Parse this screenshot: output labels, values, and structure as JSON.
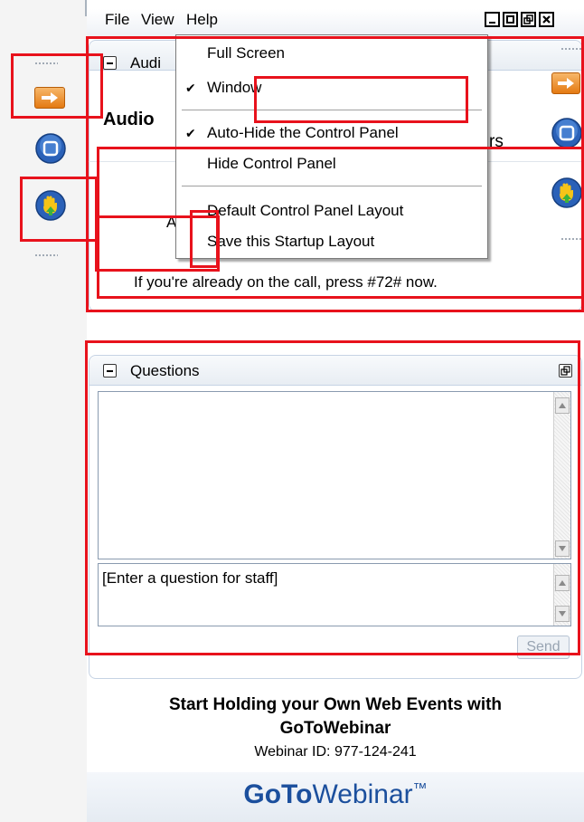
{
  "menubar": {
    "file_label": "File",
    "view_label": "View",
    "help_label": "Help"
  },
  "view_menu": {
    "items": [
      {
        "label": "Full Screen",
        "checked": false
      },
      {
        "label": "Window",
        "checked": true
      },
      {
        "label": "Auto-Hide the Control Panel",
        "checked": true
      },
      {
        "label": "Hide Control Panel",
        "checked": false
      },
      {
        "label": "Default Control Panel Layout",
        "checked": false
      },
      {
        "label": "Save this Startup Layout",
        "checked": false
      }
    ],
    "check_glyph": "✔"
  },
  "audio": {
    "header_label": "Audi",
    "title": "Audio",
    "partial_title_suffix": "rs",
    "partial_line_initial": "A",
    "instruction": "If you're already on the call, press #72# now."
  },
  "questions": {
    "header_label": "Questions",
    "input_placeholder": "[Enter a question for staff]",
    "send_label": "Send"
  },
  "promo": {
    "headline_line1": "Start Holding your Own Web Events with",
    "headline_line2": "GoToWebinar",
    "webinar_id": "Webinar ID: 977-124-241"
  },
  "logo": {
    "part1": "GoTo",
    "part2": "Webinar",
    "tm": "™"
  },
  "colors": {
    "annotation": "#e8121c",
    "accent_orange": "#e47a12",
    "accent_blue": "#1e4f9c",
    "logo_blue": "#1b4f9d"
  },
  "icons": [
    "grip-icon",
    "arrow-right-icon",
    "stop-icon",
    "raise-hand-icon",
    "minimize-icon",
    "maximize-icon",
    "restore-icon",
    "close-icon",
    "collapse-icon",
    "scroll-up-icon",
    "scroll-down-icon",
    "checkmark-icon"
  ]
}
